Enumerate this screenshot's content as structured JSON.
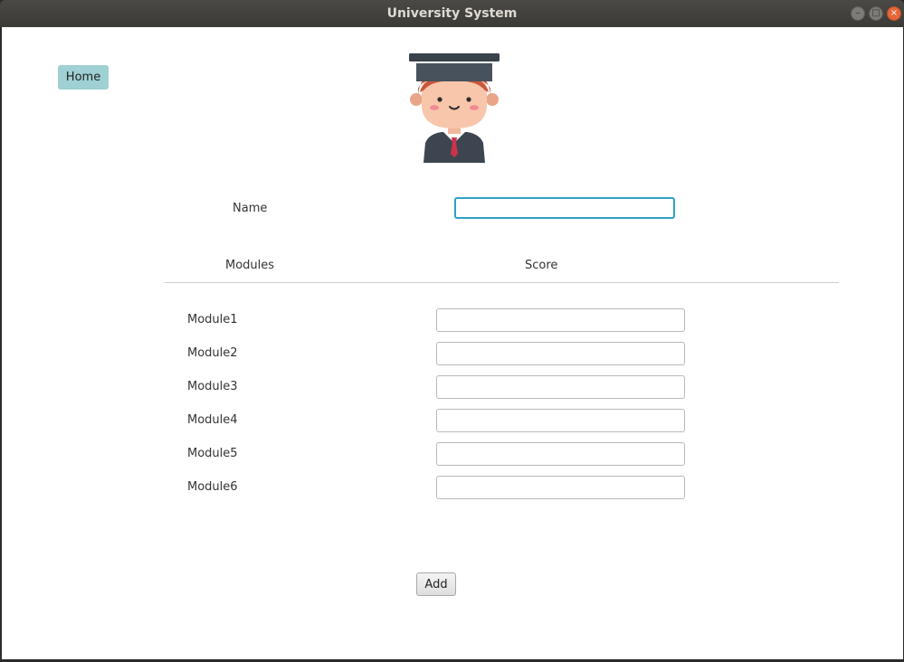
{
  "window": {
    "title": "University System"
  },
  "nav": {
    "home_label": "Home"
  },
  "avatar": {
    "icon": "graduate-student-icon"
  },
  "form": {
    "name_label": "Name",
    "name_value": "",
    "modules_header": "Modules",
    "score_header": "Score",
    "modules": [
      {
        "label": "Module1",
        "score": ""
      },
      {
        "label": "Module2",
        "score": ""
      },
      {
        "label": "Module3",
        "score": ""
      },
      {
        "label": "Module4",
        "score": ""
      },
      {
        "label": "Module5",
        "score": ""
      },
      {
        "label": "Module6",
        "score": ""
      }
    ],
    "add_label": "Add"
  },
  "colors": {
    "home_button": "#9fd0d3",
    "focus_border": "#2fa0c9",
    "close_button": "#e8653a"
  }
}
